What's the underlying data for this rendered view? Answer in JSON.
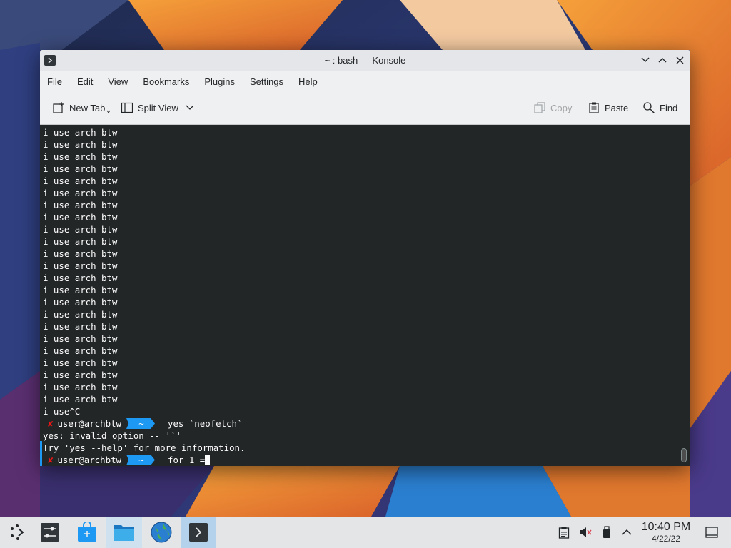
{
  "window": {
    "title": "~ : bash — Konsole",
    "controls": [
      "chevron-down-icon",
      "chevron-up-icon",
      "close-icon"
    ]
  },
  "menu": [
    "File",
    "Edit",
    "View",
    "Bookmarks",
    "Plugins",
    "Settings",
    "Help"
  ],
  "toolbar": {
    "new_tab": "New Tab",
    "split_view": "Split View",
    "copy": "Copy",
    "paste": "Paste",
    "find": "Find"
  },
  "terminal": {
    "repeat_line": "i use arch btw",
    "repeat_count": 23,
    "interrupted_line": "i use^C",
    "prompt1": {
      "mark": "✘",
      "user": "user@archbtw",
      "dir": "~",
      "command": "yes `neofetch`"
    },
    "output": [
      "yes: invalid option -- '`'",
      "Try 'yes --help' for more information."
    ],
    "prompt2": {
      "mark": "✘",
      "user": "user@archbtw",
      "dir": "~",
      "command": "for 1 ="
    }
  },
  "taskbar": {
    "apps": [
      "application-launcher-icon",
      "system-settings-icon",
      "discover-icon",
      "dolphin-icon",
      "firefox-icon",
      "konsole-icon"
    ],
    "tray": [
      "clipboard-icon",
      "volume-muted-icon",
      "usb-drive-icon",
      "tray-expand-icon"
    ],
    "time": "10:40 PM",
    "date": "4/22/22"
  },
  "colors": {
    "accent": "#1d99f3",
    "error": "#ed1515",
    "terminal_bg": "#232627"
  }
}
